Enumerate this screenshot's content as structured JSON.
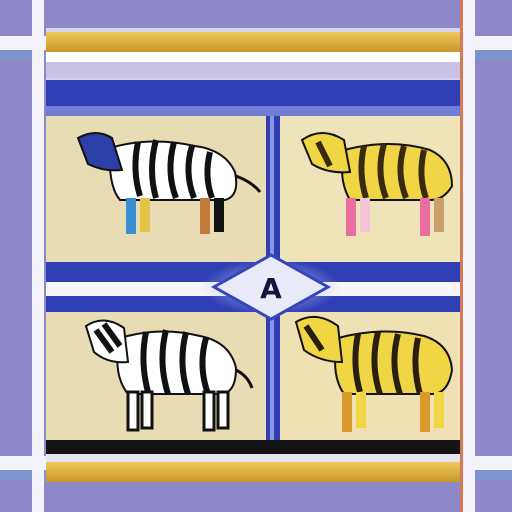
{
  "image": {
    "subject": "four-zebras-panel-grid",
    "panels": [
      {
        "id": "top-left",
        "style": "black-stripes-with-blue-head-and-colorful-legs"
      },
      {
        "id": "top-right",
        "style": "yellow-and-black-stripes-with-pink-legs"
      },
      {
        "id": "bottom-left",
        "style": "black-and-white-stripes"
      },
      {
        "id": "bottom-right",
        "style": "yellow-and-dark-stripes"
      }
    ],
    "center_glyph": "A",
    "colors": {
      "frame_lavender": "#8f88c8",
      "frame_white": "#f4f2fa",
      "royal_blue": "#2f3fb3",
      "gold": "#e1b23a",
      "panel_tan": "#e7dcb3",
      "zebra_yellow": "#f0d644",
      "stripe_dark": "#111111"
    }
  }
}
